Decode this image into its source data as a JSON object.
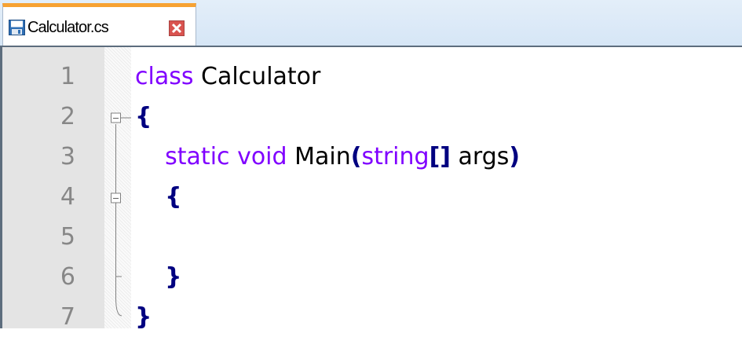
{
  "tab": {
    "filename": "Calculator.cs",
    "save_icon": "save-icon",
    "close_icon": "close-icon"
  },
  "colors": {
    "keyword": "#8000ff",
    "brace": "#000080",
    "line_number": "#878787",
    "tab_accent": "#f7a233"
  },
  "lines": [
    {
      "number": "1",
      "indent": "",
      "tokens": [
        {
          "type": "kw",
          "text": "class"
        },
        {
          "type": "ident",
          "text": " Calculator"
        }
      ]
    },
    {
      "number": "2",
      "indent": "",
      "tokens": [
        {
          "type": "brace",
          "text": "{"
        }
      ]
    },
    {
      "number": "3",
      "indent": "    ",
      "tokens": [
        {
          "type": "kw",
          "text": "static"
        },
        {
          "type": "ident",
          "text": " "
        },
        {
          "type": "kw",
          "text": "void"
        },
        {
          "type": "ident",
          "text": " Main"
        },
        {
          "type": "op",
          "text": "("
        },
        {
          "type": "kw",
          "text": "string"
        },
        {
          "type": "op",
          "text": "[]"
        },
        {
          "type": "ident",
          "text": " args"
        },
        {
          "type": "op",
          "text": ")"
        }
      ]
    },
    {
      "number": "4",
      "indent": "    ",
      "tokens": [
        {
          "type": "brace",
          "text": "{"
        }
      ]
    },
    {
      "number": "5",
      "indent": "",
      "tokens": []
    },
    {
      "number": "6",
      "indent": "    ",
      "tokens": [
        {
          "type": "brace",
          "text": "}"
        }
      ]
    },
    {
      "number": "7",
      "indent": "",
      "tokens": [
        {
          "type": "brace",
          "text": "}"
        }
      ]
    }
  ]
}
